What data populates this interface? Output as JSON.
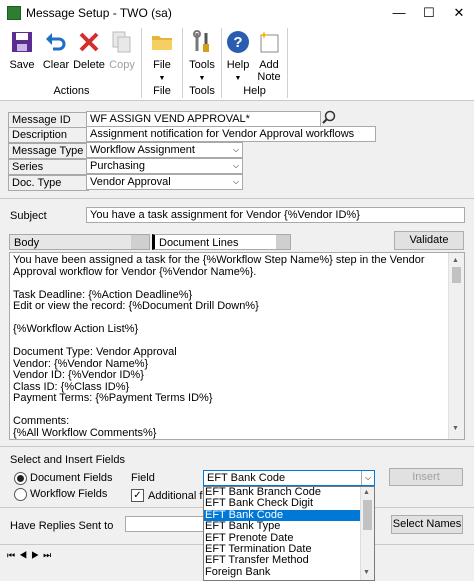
{
  "window": {
    "title": "Message Setup  -  TWO (sa)",
    "minimize": "—",
    "maximize": "☐",
    "close": "✕"
  },
  "ribbon": {
    "save": "Save",
    "clear": "Clear",
    "delete": "Delete",
    "copy": "Copy",
    "file": "File",
    "tools": "Tools",
    "help": "Help",
    "add_note_1": "Add",
    "add_note_2": "Note",
    "groups": {
      "actions": "Actions",
      "file": "File",
      "tools": "Tools",
      "help": "Help"
    }
  },
  "form": {
    "message_id_label": "Message ID",
    "message_id": "WF ASSIGN VEND APPROVAL*",
    "description_label": "Description",
    "description": "Assignment notification for Vendor Approval workflows",
    "message_type_label": "Message Type",
    "message_type": "Workflow Assignment",
    "series_label": "Series",
    "series": "Purchasing",
    "doc_type_label": "Doc. Type",
    "doc_type": "Vendor Approval",
    "subject_label": "Subject",
    "subject": "You have a task assignment for Vendor  {%Vendor ID%}"
  },
  "tabs": {
    "body": "Body",
    "document_lines": "Document Lines",
    "validate": "Validate"
  },
  "body_text": "You have been assigned a task for the {%Workflow Step Name%} step in the Vendor Approval workflow for Vendor {%Vendor Name%}.\n\nTask Deadline: {%Action Deadline%}\nEdit or view the record: {%Document Drill Down%}\n\n{%Workflow Action List%}\n\nDocument Type: Vendor Approval\nVendor: {%Vendor Name%}\nVendor ID: {%Vendor ID%}\nClass ID: {%Class ID%}\nPayment Terms: {%Payment Terms ID%}\n\nComments:\n{%All Workflow Comments%}",
  "insert": {
    "section_label": "Select and Insert Fields",
    "doc_fields": "Document Fields",
    "workflow_fields": "Workflow Fields",
    "field_label": "Field",
    "field_value": "EFT Bank Code",
    "additional_fields": "Additional fiel",
    "insert_button": "Insert",
    "options": [
      "EFT Bank Branch Code",
      "EFT Bank Check Digit",
      "EFT Bank Code",
      "EFT Bank Type",
      "EFT Prenote Date",
      "EFT Termination Date",
      "EFT Transfer Method",
      "Foreign Bank"
    ],
    "selected_index": 2
  },
  "replies": {
    "label": "Have Replies Sent to",
    "select_names": "Select Names"
  },
  "colors": {
    "selected": "#0078d7",
    "help_icon": "#2a5db0"
  }
}
